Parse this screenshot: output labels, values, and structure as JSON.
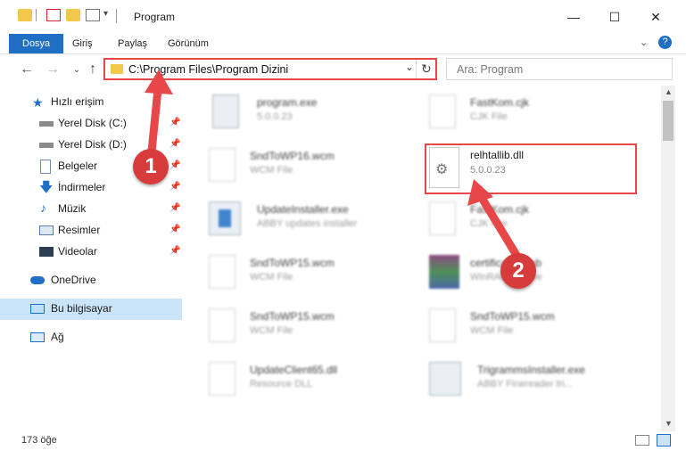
{
  "window": {
    "title": "Program"
  },
  "ribbon": {
    "tabs": [
      "Dosya",
      "Giriş",
      "Paylaş",
      "Görünüm"
    ]
  },
  "address": {
    "path": "C:\\Program Files\\Program Dizini"
  },
  "search": {
    "placeholder": "Ara: Program"
  },
  "sidebar": {
    "quick_access": "Hızlı erişim",
    "pinned": [
      "Yerel Disk (C:)",
      "Yerel Disk (D:)",
      "Belgeler",
      "İndirmeler",
      "Müzik",
      "Resimler",
      "Videolar"
    ],
    "onedrive": "OneDrive",
    "this_pc": "Bu bilgisayar",
    "network": "Ağ"
  },
  "files": [
    {
      "name": "program.exe",
      "sub": "5.0.0.23"
    },
    {
      "name": "FastKom.cjk",
      "sub": "CJK File"
    },
    {
      "name": "SndToWP16.wcm",
      "sub": "WCM File"
    },
    {
      "name": "relhtallib.dll",
      "sub": "5.0.0.23"
    },
    {
      "name": "UpdateInstaller.exe",
      "sub": "ABBY updates installer"
    },
    {
      "name": "FastKom.cjk",
      "sub": "CJK File"
    },
    {
      "name": "SndToWP15.wcm",
      "sub": "WCM File"
    },
    {
      "name": "certificates.cab",
      "sub": "WinRAR archive"
    },
    {
      "name": "SndToWP15.wcm",
      "sub": "WCM File"
    },
    {
      "name": "SndToWP15.wcm",
      "sub": "WCM File"
    },
    {
      "name": "UpdateClient65.dll",
      "sub": "Resource DLL"
    },
    {
      "name": "TrigrammsInstaller.exe",
      "sub": "ABBY Finereader tri..."
    }
  ],
  "status": {
    "count": "173 öğe"
  },
  "callouts": {
    "one": "1",
    "two": "2"
  },
  "colors": {
    "accent": "#1f6fc5",
    "annotation": "#e8474a",
    "selected": "#cce4f7"
  }
}
